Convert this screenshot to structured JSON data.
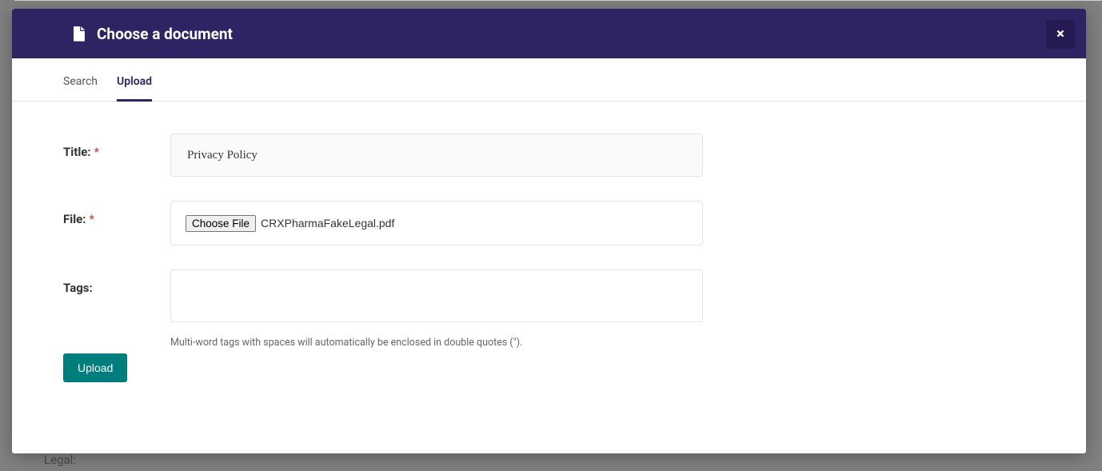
{
  "background": {
    "label": "Legal:"
  },
  "modal": {
    "title": "Choose a document",
    "close_aria": "Close"
  },
  "tabs": {
    "search": "Search",
    "upload": "Upload",
    "active": "upload"
  },
  "form": {
    "title": {
      "label": "Title:",
      "value": "Privacy Policy",
      "required": "*"
    },
    "file": {
      "label": "File:",
      "button": "Choose File",
      "filename": "CRXPharmaFakeLegal.pdf",
      "required": "*"
    },
    "tags": {
      "label": "Tags:",
      "value": "",
      "help": "Multi-word tags with spaces will automatically be enclosed in double quotes (\")."
    },
    "submit": "Upload"
  }
}
